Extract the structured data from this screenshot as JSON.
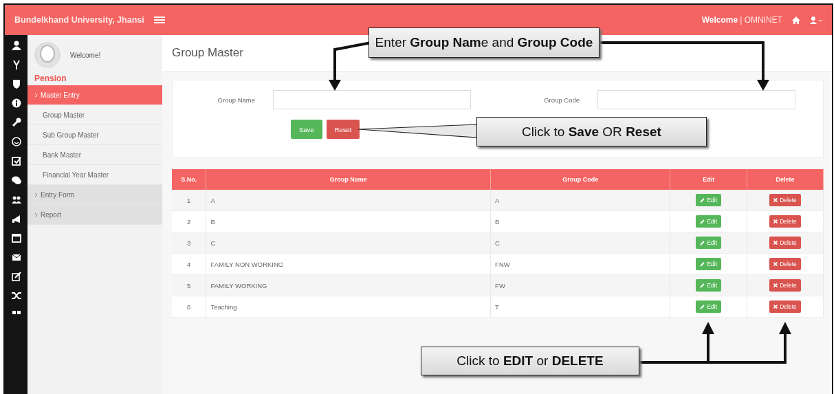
{
  "header": {
    "brand": "Bundelkhand University, Jhansi",
    "welcome_label": "Welcome",
    "separator": "|",
    "user": "OMNINET"
  },
  "sidebar": {
    "greeting": "Welcome!",
    "section": "Pension",
    "items": [
      {
        "label": "Master Entry",
        "selected": true,
        "expanded": true,
        "children": [
          {
            "label": "Group Master",
            "selected": false
          },
          {
            "label": "Sub Group Master",
            "selected": false
          },
          {
            "label": "Bank Master",
            "selected": false
          },
          {
            "label": "Financial Year Master",
            "selected": false
          }
        ]
      },
      {
        "label": "Entry Form",
        "selected": false,
        "expanded": false
      },
      {
        "label": "Report",
        "selected": false,
        "expanded": false
      }
    ]
  },
  "page": {
    "title": "Group Master"
  },
  "form": {
    "fields": [
      {
        "label": "Group Name"
      },
      {
        "label": "Group Code"
      }
    ],
    "buttons": [
      {
        "label": "Save",
        "kind": "success"
      },
      {
        "label": "Reset",
        "kind": "danger"
      }
    ]
  },
  "table": {
    "columns": [
      "S.No.",
      "Group Name",
      "Group Code",
      "Edit",
      "Delete"
    ],
    "rows": [
      {
        "sno": "1",
        "name": "A",
        "code": "A",
        "edit": "Edit",
        "delete": "Delete"
      },
      {
        "sno": "2",
        "name": "B",
        "code": "B",
        "edit": "Edit",
        "delete": "Delete"
      },
      {
        "sno": "3",
        "name": "C",
        "code": "C",
        "edit": "Edit",
        "delete": "Delete"
      },
      {
        "sno": "4",
        "name": "FAMILY NON WORKING",
        "code": "FNW",
        "edit": "Edit",
        "delete": "Delete"
      },
      {
        "sno": "5",
        "name": "FAMILY WORKING",
        "code": "FW",
        "edit": "Edit",
        "delete": "Delete"
      },
      {
        "sno": "6",
        "name": "Teaching",
        "code": "T",
        "edit": "Edit",
        "delete": "Delete"
      }
    ]
  },
  "callouts": [
    {
      "text": "Enter **Group Nam**e and **Group Code**"
    },
    {
      "text": "Click to **Save** OR **Reset**"
    },
    {
      "text": "Click to **EDIT** or **DELETE**"
    }
  ]
}
